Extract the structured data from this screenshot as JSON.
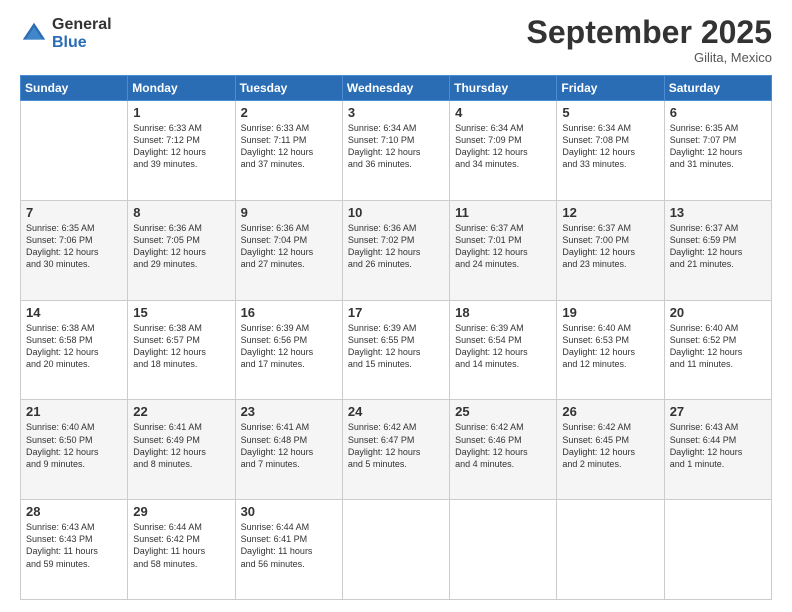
{
  "logo": {
    "general": "General",
    "blue": "Blue"
  },
  "header": {
    "month": "September 2025",
    "location": "Gilita, Mexico"
  },
  "weekdays": [
    "Sunday",
    "Monday",
    "Tuesday",
    "Wednesday",
    "Thursday",
    "Friday",
    "Saturday"
  ],
  "weeks": [
    [
      {
        "day": "",
        "text": ""
      },
      {
        "day": "1",
        "text": "Sunrise: 6:33 AM\nSunset: 7:12 PM\nDaylight: 12 hours\nand 39 minutes."
      },
      {
        "day": "2",
        "text": "Sunrise: 6:33 AM\nSunset: 7:11 PM\nDaylight: 12 hours\nand 37 minutes."
      },
      {
        "day": "3",
        "text": "Sunrise: 6:34 AM\nSunset: 7:10 PM\nDaylight: 12 hours\nand 36 minutes."
      },
      {
        "day": "4",
        "text": "Sunrise: 6:34 AM\nSunset: 7:09 PM\nDaylight: 12 hours\nand 34 minutes."
      },
      {
        "day": "5",
        "text": "Sunrise: 6:34 AM\nSunset: 7:08 PM\nDaylight: 12 hours\nand 33 minutes."
      },
      {
        "day": "6",
        "text": "Sunrise: 6:35 AM\nSunset: 7:07 PM\nDaylight: 12 hours\nand 31 minutes."
      }
    ],
    [
      {
        "day": "7",
        "text": "Sunrise: 6:35 AM\nSunset: 7:06 PM\nDaylight: 12 hours\nand 30 minutes."
      },
      {
        "day": "8",
        "text": "Sunrise: 6:36 AM\nSunset: 7:05 PM\nDaylight: 12 hours\nand 29 minutes."
      },
      {
        "day": "9",
        "text": "Sunrise: 6:36 AM\nSunset: 7:04 PM\nDaylight: 12 hours\nand 27 minutes."
      },
      {
        "day": "10",
        "text": "Sunrise: 6:36 AM\nSunset: 7:02 PM\nDaylight: 12 hours\nand 26 minutes."
      },
      {
        "day": "11",
        "text": "Sunrise: 6:37 AM\nSunset: 7:01 PM\nDaylight: 12 hours\nand 24 minutes."
      },
      {
        "day": "12",
        "text": "Sunrise: 6:37 AM\nSunset: 7:00 PM\nDaylight: 12 hours\nand 23 minutes."
      },
      {
        "day": "13",
        "text": "Sunrise: 6:37 AM\nSunset: 6:59 PM\nDaylight: 12 hours\nand 21 minutes."
      }
    ],
    [
      {
        "day": "14",
        "text": "Sunrise: 6:38 AM\nSunset: 6:58 PM\nDaylight: 12 hours\nand 20 minutes."
      },
      {
        "day": "15",
        "text": "Sunrise: 6:38 AM\nSunset: 6:57 PM\nDaylight: 12 hours\nand 18 minutes."
      },
      {
        "day": "16",
        "text": "Sunrise: 6:39 AM\nSunset: 6:56 PM\nDaylight: 12 hours\nand 17 minutes."
      },
      {
        "day": "17",
        "text": "Sunrise: 6:39 AM\nSunset: 6:55 PM\nDaylight: 12 hours\nand 15 minutes."
      },
      {
        "day": "18",
        "text": "Sunrise: 6:39 AM\nSunset: 6:54 PM\nDaylight: 12 hours\nand 14 minutes."
      },
      {
        "day": "19",
        "text": "Sunrise: 6:40 AM\nSunset: 6:53 PM\nDaylight: 12 hours\nand 12 minutes."
      },
      {
        "day": "20",
        "text": "Sunrise: 6:40 AM\nSunset: 6:52 PM\nDaylight: 12 hours\nand 11 minutes."
      }
    ],
    [
      {
        "day": "21",
        "text": "Sunrise: 6:40 AM\nSunset: 6:50 PM\nDaylight: 12 hours\nand 9 minutes."
      },
      {
        "day": "22",
        "text": "Sunrise: 6:41 AM\nSunset: 6:49 PM\nDaylight: 12 hours\nand 8 minutes."
      },
      {
        "day": "23",
        "text": "Sunrise: 6:41 AM\nSunset: 6:48 PM\nDaylight: 12 hours\nand 7 minutes."
      },
      {
        "day": "24",
        "text": "Sunrise: 6:42 AM\nSunset: 6:47 PM\nDaylight: 12 hours\nand 5 minutes."
      },
      {
        "day": "25",
        "text": "Sunrise: 6:42 AM\nSunset: 6:46 PM\nDaylight: 12 hours\nand 4 minutes."
      },
      {
        "day": "26",
        "text": "Sunrise: 6:42 AM\nSunset: 6:45 PM\nDaylight: 12 hours\nand 2 minutes."
      },
      {
        "day": "27",
        "text": "Sunrise: 6:43 AM\nSunset: 6:44 PM\nDaylight: 12 hours\nand 1 minute."
      }
    ],
    [
      {
        "day": "28",
        "text": "Sunrise: 6:43 AM\nSunset: 6:43 PM\nDaylight: 11 hours\nand 59 minutes."
      },
      {
        "day": "29",
        "text": "Sunrise: 6:44 AM\nSunset: 6:42 PM\nDaylight: 11 hours\nand 58 minutes."
      },
      {
        "day": "30",
        "text": "Sunrise: 6:44 AM\nSunset: 6:41 PM\nDaylight: 11 hours\nand 56 minutes."
      },
      {
        "day": "",
        "text": ""
      },
      {
        "day": "",
        "text": ""
      },
      {
        "day": "",
        "text": ""
      },
      {
        "day": "",
        "text": ""
      }
    ]
  ]
}
